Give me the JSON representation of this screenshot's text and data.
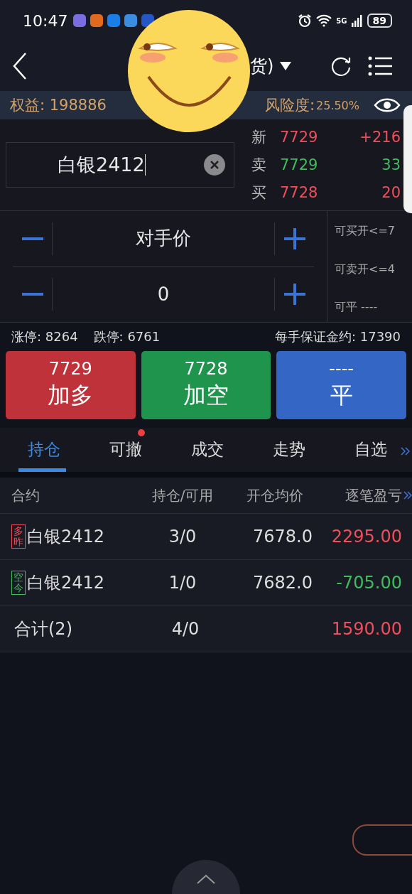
{
  "status_bar": {
    "time": "10:47",
    "network": "5G",
    "battery": "89"
  },
  "nav": {
    "title": "货)"
  },
  "account": {
    "equity_label": "权益:",
    "equity": "198886",
    "risk_label": "风险度:",
    "risk": "25.50%"
  },
  "order": {
    "contract": "白银2412",
    "quotes": [
      {
        "label": "新",
        "price": "7729",
        "value": "+216",
        "color": "#ef4f5a"
      },
      {
        "label": "卖",
        "price": "7729",
        "value": "33",
        "color": "#3fbd5d"
      },
      {
        "label": "买",
        "price": "7728",
        "value": "20",
        "color": "#ef4f5a"
      }
    ],
    "price": "对手价",
    "quantity": "0",
    "limits": [
      "可买开<=7",
      "可卖开<=4",
      "可平 ----"
    ]
  },
  "info": {
    "limit_up": "涨停: 8264",
    "limit_down": "跌停: 6761",
    "margin": "每手保证金约: 17390"
  },
  "actions": [
    {
      "price": "7729",
      "label": "加多",
      "kind": "buy"
    },
    {
      "price": "7728",
      "label": "加空",
      "kind": "sell"
    },
    {
      "price": "----",
      "label": "平",
      "kind": "close"
    }
  ],
  "tabs": [
    {
      "label": "持仓",
      "selected": true,
      "badge": false
    },
    {
      "label": "可撤",
      "selected": false,
      "badge": true
    },
    {
      "label": "成交",
      "selected": false,
      "badge": false
    },
    {
      "label": "走势",
      "selected": false,
      "badge": false
    },
    {
      "label": "自选",
      "selected": false,
      "badge": false
    }
  ],
  "table": {
    "columns": [
      "合约",
      "持仓/可用",
      "开仓均价",
      "逐笔盈亏"
    ],
    "rows": [
      {
        "tag": "多昨",
        "contract": "白银2412",
        "position": "3/0",
        "avg_price": "7678.0",
        "pnl": "2295.00",
        "color": "#ef4f5a"
      },
      {
        "tag": "空今",
        "contract": "白银2412",
        "position": "1/0",
        "avg_price": "7682.0",
        "pnl": "-705.00",
        "color": "#3fbd5d"
      }
    ],
    "total": {
      "label": "合计(2)",
      "position": "4/0",
      "pnl": "1590.00",
      "color": "#ef4f5a"
    }
  }
}
